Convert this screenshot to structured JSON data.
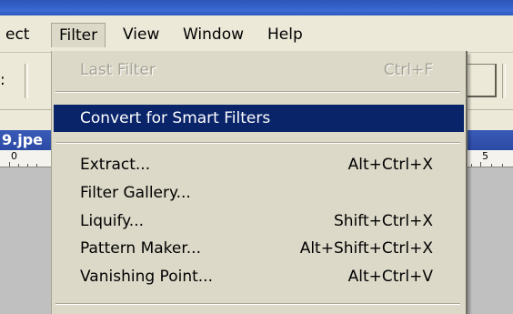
{
  "menubar": {
    "items": [
      {
        "label": "ect"
      },
      {
        "label": "Filter"
      },
      {
        "label": "View"
      },
      {
        "label": "Window"
      },
      {
        "label": "Help"
      }
    ]
  },
  "toolbar": {
    "left_fragment": ":"
  },
  "document": {
    "tab_label": "9.jpe"
  },
  "ruler": {
    "left_label": "0",
    "right_label": "5"
  },
  "filter_menu": {
    "items": [
      {
        "label": "Last Filter",
        "shortcut": "Ctrl+F",
        "state": "disabled"
      },
      {
        "label": "Convert for Smart Filters",
        "shortcut": "",
        "state": "selected"
      },
      {
        "label": "Extract...",
        "shortcut": "Alt+Ctrl+X",
        "state": "normal"
      },
      {
        "label": "Filter Gallery...",
        "shortcut": "",
        "state": "normal"
      },
      {
        "label": "Liquify...",
        "shortcut": "Shift+Ctrl+X",
        "state": "normal"
      },
      {
        "label": "Pattern Maker...",
        "shortcut": "Alt+Shift+Ctrl+X",
        "state": "normal"
      },
      {
        "label": "Vanishing Point...",
        "shortcut": "Alt+Ctrl+V",
        "state": "normal"
      }
    ]
  },
  "colors": {
    "menu_background": "#dcd9c8",
    "selection": "#0a246a",
    "disabled_text": "#a6a394"
  }
}
